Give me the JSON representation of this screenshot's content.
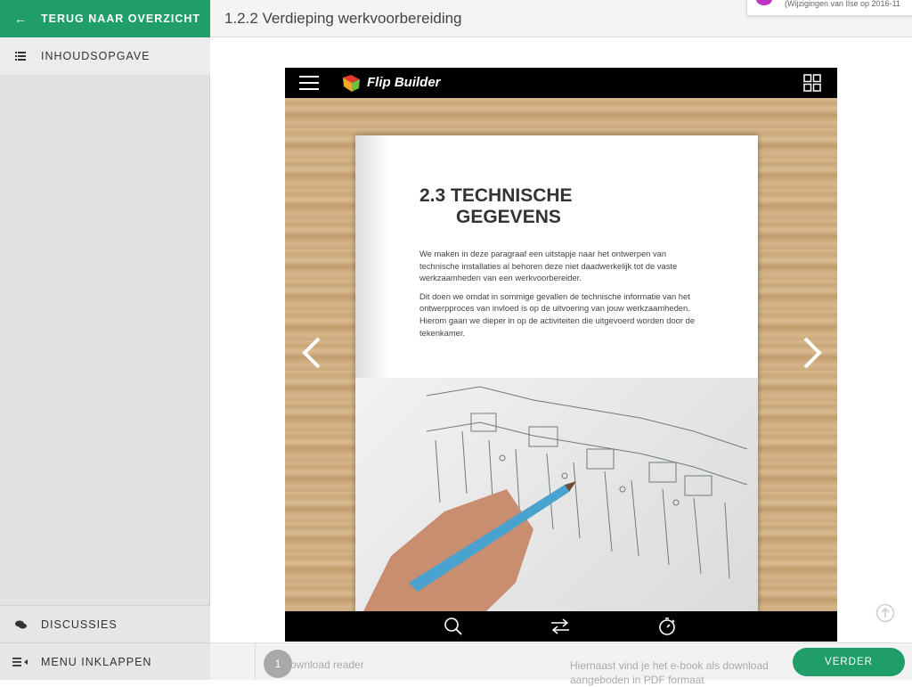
{
  "sidebar": {
    "back_label": "TERUG NAAR OVERZICHT",
    "toc_label": "INHOUDSOPGAVE",
    "discussions_label": "DISCUSSIES",
    "collapse_label": "MENU INKLAPPEN"
  },
  "header": {
    "title": "1.2.2 Verdieping werkvoorbereiding",
    "notification": "(Wijzigingen van Ilse op 2016-11"
  },
  "viewer": {
    "brand": "Flip Builder",
    "page_heading_line1": "2.3 TECHNISCHE",
    "page_heading_line2": "GEGEVENS",
    "paragraph1": "We maken in deze paragraaf een uitstapje naar het ontwerpen van technische installaties al behoren deze niet daadwerkelijk tot de vaste werkzaamheden van een werkvoorbereider.",
    "paragraph2": "Dit doen we omdat in sommige gevallen de technische informatie van het ontwerpproces van invloed is op de uitvoering van jouw werkzaamheden. Hierom gaan we dieper in op de activiteiten die uitgevoerd worden door de tekenkamer.",
    "photo_description": "hand with pencil over electrical schematic"
  },
  "footer": {
    "page_number": "1",
    "left_text": "ownload reader",
    "right_text": "Hiernaast vind je het e-book als download aangeboden in PDF formaat",
    "next_label": "VERDER"
  },
  "colors": {
    "accent": "#1f9e6a",
    "sidebar_bg": "#e2e2e2",
    "viewer_bar": "#000000"
  }
}
